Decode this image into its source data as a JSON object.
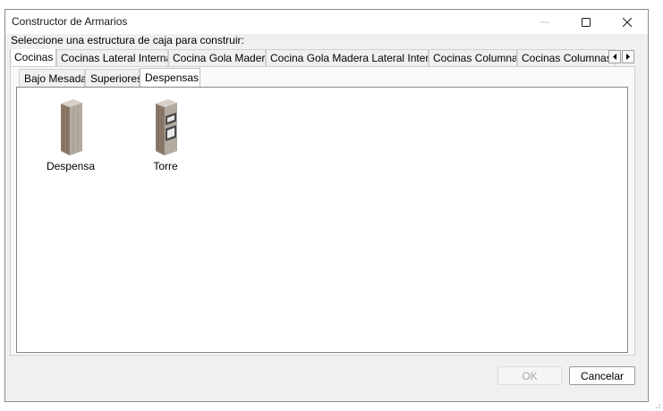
{
  "window": {
    "title": "Constructor de Armarios",
    "controls": {
      "minimize_icon": "minimize-icon",
      "maximize_icon": "maximize-icon",
      "close_icon": "close-icon"
    }
  },
  "instruction": "Seleccione una estructura de caja para construir:",
  "top_tabs": [
    {
      "label": "Cocinas",
      "active": true
    },
    {
      "label": "Cocinas Lateral Interna",
      "active": false
    },
    {
      "label": "Cocina Gola Madera",
      "active": false
    },
    {
      "label": "Cocina Gola Madera Lateral Interna",
      "active": false
    },
    {
      "label": "Cocinas Columnas",
      "active": false
    },
    {
      "label": "Cocinas Columnas La",
      "active": false
    }
  ],
  "tab_scroll": {
    "left_icon": "arrow-left-icon",
    "right_icon": "arrow-right-icon"
  },
  "inner_tabs": [
    {
      "label": "Bajo Mesada",
      "active": false
    },
    {
      "label": "Superiores",
      "active": false
    },
    {
      "label": "Despensas",
      "active": true
    }
  ],
  "items": [
    {
      "label": "Despensa",
      "icon": "pantry-cabinet-icon"
    },
    {
      "label": "Torre",
      "icon": "oven-tower-cabinet-icon"
    }
  ],
  "buttons": {
    "ok": {
      "label": "OK",
      "enabled": false
    },
    "cancel": {
      "label": "Cancelar",
      "enabled": true
    }
  },
  "colors": {
    "wood_front": "#8b7a6a",
    "wood_side": "#b3aaa0",
    "wood_top": "#d6d0c8"
  }
}
